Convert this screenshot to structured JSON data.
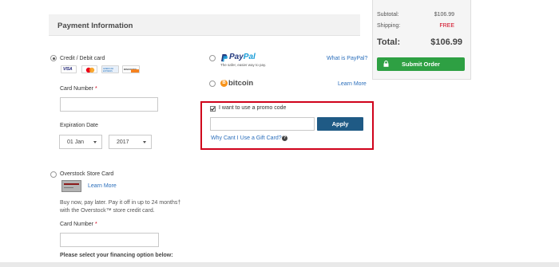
{
  "header": {
    "title": "Payment Information"
  },
  "summary": {
    "subtotal_label": "Subtotal:",
    "subtotal_value": "$106.99",
    "shipping_label": "Shipping:",
    "shipping_value": "FREE",
    "total_label": "Total:",
    "total_value": "$106.99",
    "submit_label": "Submit Order",
    "free_color": "#d0021b",
    "submit_color": "#2ea043"
  },
  "credit_card": {
    "option_label": "Credit / Debit card",
    "logos": [
      "VISA",
      "MasterCard",
      "AMERICAN EXPRESS",
      "DISCOVER"
    ],
    "card_number_label": "Card Number",
    "required_mark": "*",
    "card_number_value": "",
    "expiration_label": "Expiration Date",
    "month_value": "01 Jan",
    "year_value": "2017"
  },
  "paypal": {
    "logo_text_1": "Pay",
    "logo_text_2": "Pal",
    "tagline": "The safer, easier way to pay.",
    "link": "What is PayPal?"
  },
  "bitcoin": {
    "logo_symbol": "B",
    "logo_text": "bitcoin",
    "link": "Learn More"
  },
  "promo": {
    "checkbox_label": "I want to use a promo code",
    "checked": true,
    "input_value": "",
    "apply_label": "Apply",
    "gift_card_link": "Why Cant I Use a Gift Card?",
    "help_icon": "?"
  },
  "store_card": {
    "option_label": "Overstock Store Card",
    "learn_more": "Learn More",
    "description_1": "Buy now, pay later. Pay it off in up to 24 months†",
    "description_2": "with the Overstock™ store credit card.",
    "card_number_label": "Card Number",
    "required_mark": "*",
    "card_number_value": "",
    "financing_label": "Please select your financing option below:"
  }
}
